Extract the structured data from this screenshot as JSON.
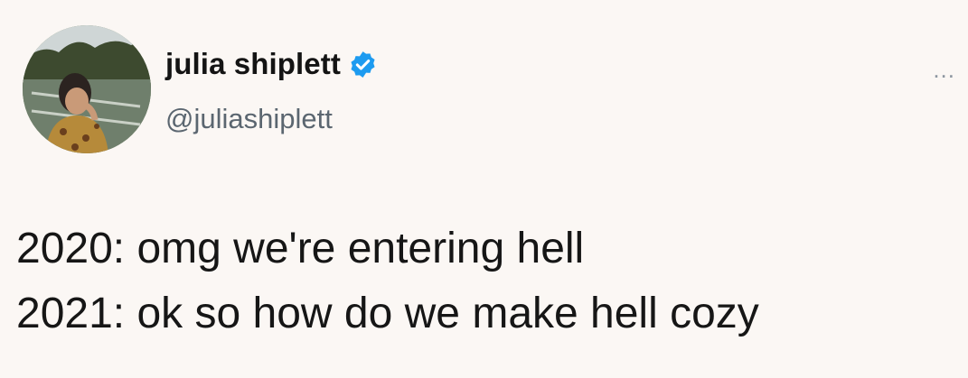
{
  "author": {
    "display_name": "julia shiplett",
    "handle": "@juliashiplett",
    "verified": true,
    "verified_color": "#1d9bf0"
  },
  "menu": {
    "more_label": "..."
  },
  "tweet": {
    "lines": [
      "2020: omg we're entering hell",
      "2021: ok so how do we make hell cozy"
    ]
  },
  "icons": {
    "avatar": "profile-photo",
    "verified": "verified-badge-icon",
    "more": "more-options-icon"
  }
}
